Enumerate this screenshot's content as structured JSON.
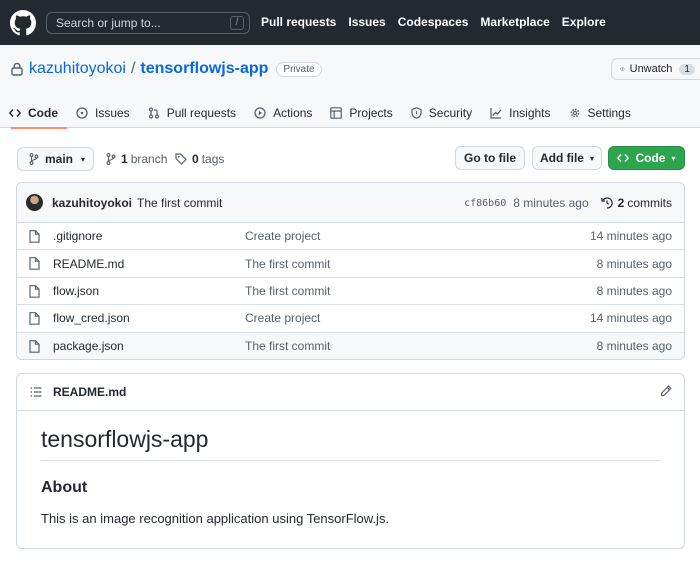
{
  "header": {
    "search_placeholder": "Search or jump to...",
    "search_shortcut": "/",
    "nav": [
      "Pull requests",
      "Issues",
      "Codespaces",
      "Marketplace",
      "Explore"
    ]
  },
  "repo": {
    "owner": "kazuhitoyokoi",
    "separator": "/",
    "name": "tensorflowjs-app",
    "visibility": "Private",
    "watch_label": "Unwatch",
    "watch_count": "1"
  },
  "tabs": [
    {
      "label": "Code",
      "icon": "code-icon",
      "active": true
    },
    {
      "label": "Issues",
      "icon": "issue-icon"
    },
    {
      "label": "Pull requests",
      "icon": "pull-request-icon"
    },
    {
      "label": "Actions",
      "icon": "play-icon"
    },
    {
      "label": "Projects",
      "icon": "table-icon"
    },
    {
      "label": "Security",
      "icon": "shield-icon"
    },
    {
      "label": "Insights",
      "icon": "graph-icon"
    },
    {
      "label": "Settings",
      "icon": "gear-icon"
    }
  ],
  "branchbar": {
    "branch": "main",
    "branch_count": "1",
    "branch_label": "branch",
    "tag_count": "0",
    "tag_label": "tags",
    "go_to_file": "Go to file",
    "add_file": "Add file",
    "code": "Code"
  },
  "commit": {
    "author": "kazuhitoyokoi",
    "message": "The first commit",
    "sha": "cf86b60",
    "time": "8 minutes ago",
    "commits_count": "2",
    "commits_label": "commits"
  },
  "files": [
    {
      "name": ".gitignore",
      "message": "Create project",
      "time": "14 minutes ago"
    },
    {
      "name": "README.md",
      "message": "The first commit",
      "time": "8 minutes ago"
    },
    {
      "name": "flow.json",
      "message": "The first commit",
      "time": "8 minutes ago"
    },
    {
      "name": "flow_cred.json",
      "message": "Create project",
      "time": "14 minutes ago"
    },
    {
      "name": "package.json",
      "message": "The first commit",
      "time": "8 minutes ago"
    }
  ],
  "readme": {
    "filename": "README.md",
    "title": "tensorflowjs-app",
    "heading": "About",
    "text": "This is an image recognition application using TensorFlow.js."
  },
  "colors": {
    "header_bg": "#24292f",
    "link": "#0969da",
    "active_tab_underline": "#fd8c73",
    "code_button": "#2da44e"
  }
}
